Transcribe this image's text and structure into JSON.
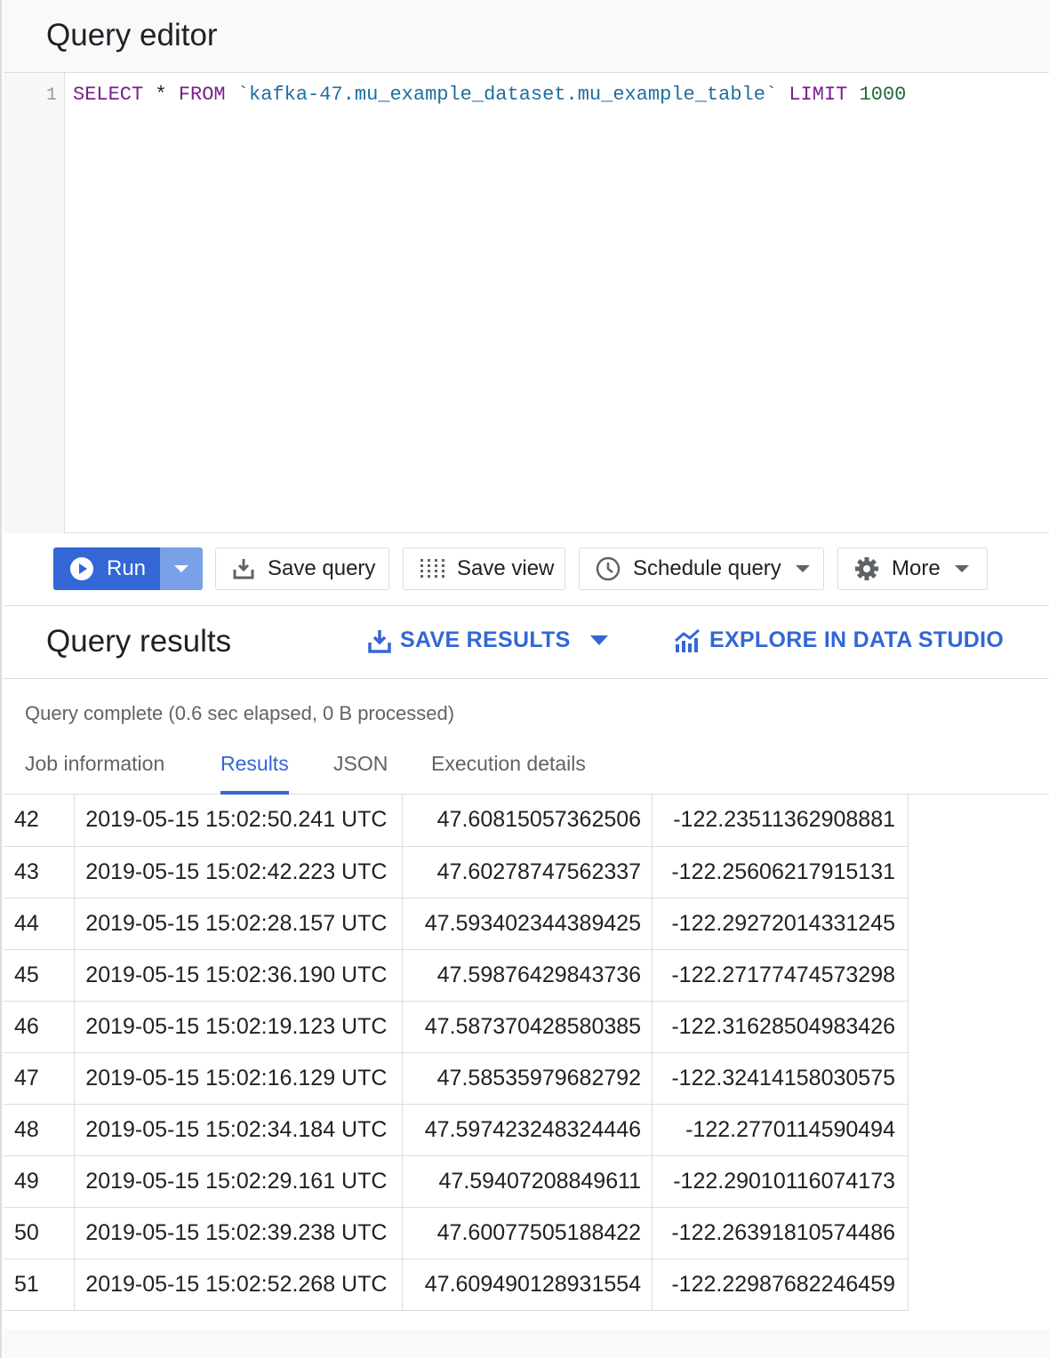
{
  "editor": {
    "title": "Query editor",
    "line_number": "1",
    "code": {
      "select": "SELECT",
      "star": "*",
      "from": "FROM",
      "table": "`kafka-47.mu_example_dataset.mu_example_table`",
      "limit": "LIMIT",
      "limit_value": "1000"
    }
  },
  "toolbar": {
    "run_label": "Run",
    "save_query_label": "Save query",
    "save_view_label": "Save view",
    "schedule_query_label": "Schedule query",
    "more_label": "More"
  },
  "results": {
    "title": "Query results",
    "save_results_label": "SAVE RESULTS",
    "explore_label": "EXPLORE IN DATA STUDIO",
    "status": "Query complete (0.6 sec elapsed, 0 B processed)",
    "tabs": [
      {
        "label": "Job information"
      },
      {
        "label": "Results"
      },
      {
        "label": "JSON"
      },
      {
        "label": "Execution details"
      }
    ],
    "active_tab": "Results",
    "rows": [
      {
        "row": "42",
        "timestamp": "2019-05-15 15:02:50.241 UTC",
        "lat": "47.60815057362506",
        "lon": "-122.23511362908881"
      },
      {
        "row": "43",
        "timestamp": "2019-05-15 15:02:42.223 UTC",
        "lat": "47.60278747562337",
        "lon": "-122.25606217915131"
      },
      {
        "row": "44",
        "timestamp": "2019-05-15 15:02:28.157 UTC",
        "lat": "47.593402344389425",
        "lon": "-122.29272014331245"
      },
      {
        "row": "45",
        "timestamp": "2019-05-15 15:02:36.190 UTC",
        "lat": "47.59876429843736",
        "lon": "-122.27177474573298"
      },
      {
        "row": "46",
        "timestamp": "2019-05-15 15:02:19.123 UTC",
        "lat": "47.587370428580385",
        "lon": "-122.31628504983426"
      },
      {
        "row": "47",
        "timestamp": "2019-05-15 15:02:16.129 UTC",
        "lat": "47.58535979682792",
        "lon": "-122.32414158030575"
      },
      {
        "row": "48",
        "timestamp": "2019-05-15 15:02:34.184 UTC",
        "lat": "47.597423248324446",
        "lon": "-122.2770114590494"
      },
      {
        "row": "49",
        "timestamp": "2019-05-15 15:02:29.161 UTC",
        "lat": "47.59407208849611",
        "lon": "-122.29010116074173"
      },
      {
        "row": "50",
        "timestamp": "2019-05-15 15:02:39.238 UTC",
        "lat": "47.60077505188422",
        "lon": "-122.26391810574486"
      },
      {
        "row": "51",
        "timestamp": "2019-05-15 15:02:52.268 UTC",
        "lat": "47.609490128931554",
        "lon": "-122.22987682246459"
      }
    ]
  },
  "colors": {
    "accent": "#3367d6",
    "keyword": "#7a1f8c",
    "string": "#1f6e9e",
    "number": "#1f6b3a"
  },
  "icons": {
    "run": "play-circle-icon",
    "save_query": "download-tray-icon",
    "save_view": "dotted-grid-icon",
    "schedule_query": "clock-icon",
    "more": "gear-icon",
    "save_results": "download-icon",
    "explore": "chart-icon"
  }
}
